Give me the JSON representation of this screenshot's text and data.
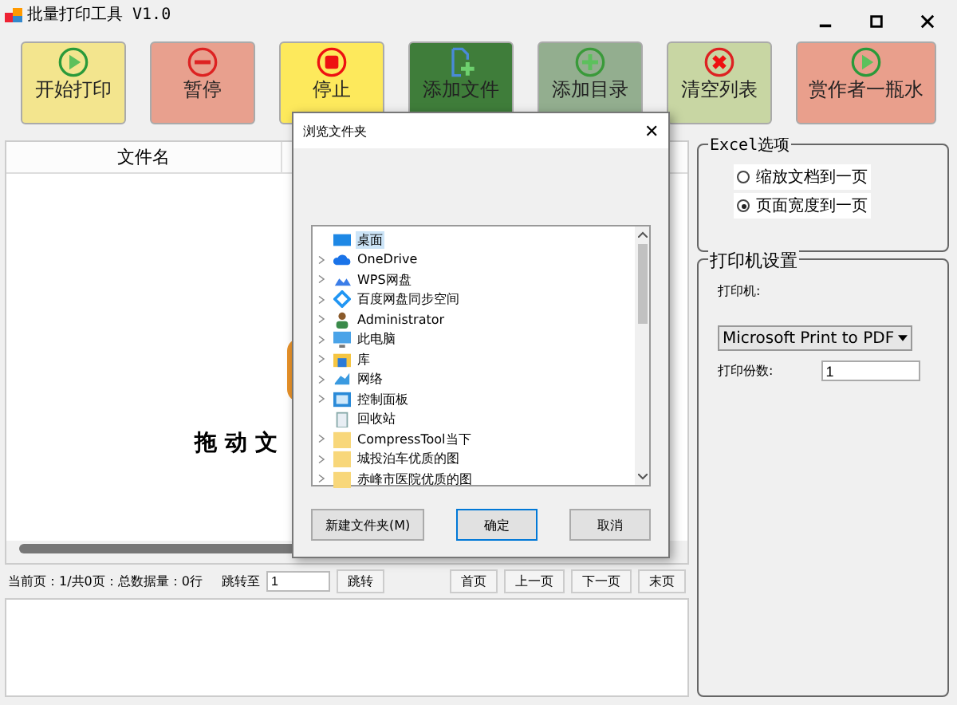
{
  "window": {
    "title": "批量打印工具 V1.0"
  },
  "toolbar": [
    {
      "label": "开始打印",
      "kind": "play",
      "color": "#f3e58e"
    },
    {
      "label": "暂停",
      "kind": "minus",
      "color": "#e8a08e"
    },
    {
      "label": "停止",
      "kind": "stop",
      "color": "#fde95c"
    },
    {
      "label": "添加文件",
      "kind": "file",
      "color": "#3f7d3a"
    },
    {
      "label": "添加目录",
      "kind": "plus",
      "color": "#93ae8f"
    },
    {
      "label": "清空列表",
      "kind": "cross",
      "color": "#c8d6a3"
    },
    {
      "label": "赏作者一瓶水",
      "kind": "play",
      "color": "#e99f8c"
    }
  ],
  "table": {
    "columns": [
      "文件名"
    ],
    "hint": "拖动文"
  },
  "pager": {
    "status": "当前页：1/共0页：总数据量：0行",
    "jump_label": "跳转至",
    "jump_value": "1",
    "jump_button": "跳转",
    "buttons": [
      "首页",
      "上一页",
      "下一页",
      "末页"
    ]
  },
  "excel_options": {
    "title": "Excel选项",
    "options": [
      {
        "label": "缩放文档到一页",
        "selected": false
      },
      {
        "label": "页面宽度到一页",
        "selected": true
      }
    ]
  },
  "printer_settings": {
    "title": "打印机设置",
    "printer_label": "打印机:",
    "printer_value": "Microsoft Print to PDF",
    "copies_label": "打印份数:",
    "copies_value": "1"
  },
  "dialog": {
    "title": "浏览文件夹",
    "close": "✕",
    "tree": [
      {
        "label": "桌面",
        "kind": "desktop",
        "expandable": false,
        "selected": true
      },
      {
        "label": "OneDrive",
        "kind": "cloud",
        "expandable": true,
        "selected": false
      },
      {
        "label": "WPS网盘",
        "kind": "cloud2",
        "expandable": true,
        "selected": false
      },
      {
        "label": "百度网盘同步空间",
        "kind": "diamond",
        "expandable": true,
        "selected": false
      },
      {
        "label": "Administrator",
        "kind": "person",
        "expandable": true,
        "selected": false
      },
      {
        "label": "此电脑",
        "kind": "computer",
        "expandable": true,
        "selected": false
      },
      {
        "label": "库",
        "kind": "library",
        "expandable": true,
        "selected": false
      },
      {
        "label": "网络",
        "kind": "network",
        "expandable": true,
        "selected": false
      },
      {
        "label": "控制面板",
        "kind": "panel",
        "expandable": true,
        "selected": false
      },
      {
        "label": "回收站",
        "kind": "bin",
        "expandable": false,
        "selected": false
      },
      {
        "label": "CompressTool当下",
        "kind": "folder",
        "expandable": true,
        "selected": false
      },
      {
        "label": "城投泊车优质的图",
        "kind": "folder",
        "expandable": true,
        "selected": false
      },
      {
        "label": "赤峰市医院优质的图",
        "kind": "folder",
        "expandable": true,
        "selected": false
      }
    ],
    "buttons": [
      {
        "label": "新建文件夹(M)",
        "kind": "normal"
      },
      {
        "label": "确定",
        "kind": "default"
      },
      {
        "label": "取消",
        "kind": "normal"
      }
    ]
  }
}
